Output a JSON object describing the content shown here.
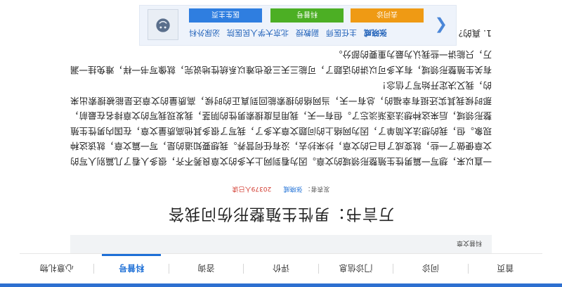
{
  "nav": {
    "items": [
      {
        "label": "首页",
        "active": false
      },
      {
        "label": "问诊",
        "active": false
      },
      {
        "label": "门诊信息",
        "active": false
      },
      {
        "label": "评价",
        "active": false
      },
      {
        "label": "咨询",
        "active": false
      },
      {
        "label": "科普号",
        "active": true
      },
      {
        "label": "心意礼物",
        "active": false
      }
    ]
  },
  "breadcrumb": "科普文章",
  "article": {
    "title": "万言书：男性生殖整形伤问我答",
    "meta_prefix": "发表者：",
    "author": "张晓威",
    "reads": "20379人已读",
    "paragraphs": [
      "一直以来，想写一篇男性生殖整形领域的文章。因为看到网上大多的文章良莠不齐，很多人看了几篇别人写的文章便做了一些，就变成了自己的文章，抄来抄去，没有任何营养。我想要知道的是，写一篇文章，就该这种现象。但，我的想法太简单了，因为网络上的问题文章太多了，我写了很多其他高质量文章，在国内男性生殖整形领域，后来这种想法逐渐淡忘了。但有一天，我用百度搜索男性的阴茎，我发现我写的文章排名在最前，那时候我其实还挺有幸福的，总有一天，当网络的搜索能回到真正的时候，高质量的文章还是能被搜索出来的，我又决定开始写了信念！",
      "有关生殖整形领域，有太多可以讲的话题了，可能三天三夜也难以系统性地说完，就像写书一样，难免挂一漏万，只能讲一些我认为最为重要的部分。",
      "1. 真的？"
    ]
  },
  "doctor_card": {
    "name": "张晓威",
    "title": "主任医师",
    "rank": "副教授",
    "hospital": "北京大学人民医院",
    "department": "泌尿外科",
    "buttons": {
      "home": "医生主页",
      "kepu": "科普号",
      "consult": "去问诊"
    },
    "avatar_icon": "doctor-avatar-icon",
    "chevron_icon": "chevron-left-icon"
  },
  "colors": {
    "accent": "#1d6fd6",
    "top_bar": "#2d6fd0",
    "button_blue": "#2f7ee0",
    "button_green": "#4caf24",
    "button_orange": "#ef9a14",
    "card_bg": "#eef3fb",
    "reads_red": "#d23a2f"
  }
}
